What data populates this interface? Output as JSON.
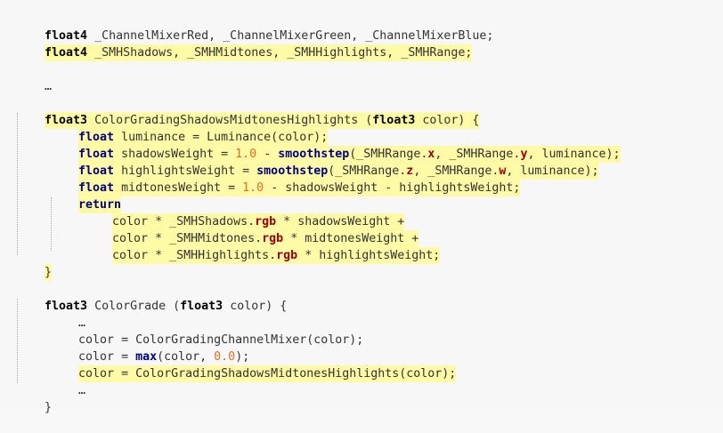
{
  "lines": {
    "l1": "float4 _ChannelMixerRed, _ChannelMixerGreen, _ChannelMixerBlue;",
    "l2a": "float4",
    "l2b": " _SMHShadows, _SMHMidtones, _SMHHighlights, _SMHRange;",
    "l4": "…",
    "l6a": "float3",
    "l6b": " ColorGradingShadowsMidtonesHighlights (",
    "l6c": "float3",
    "l6d": " color) {",
    "l7a": "float",
    "l7b": " luminance = Luminance(color);",
    "l8a": "float",
    "l8b": " shadowsWeight = ",
    "l8c": "1.0",
    "l8d": " - ",
    "l8e": "smoothstep",
    "l8f": "(_SMHRange.",
    "l8g": "x",
    "l8h": ", _SMHRange.",
    "l8i": "y",
    "l8j": ", luminance);",
    "l9a": "float",
    "l9b": " highlightsWeight = ",
    "l9c": "smoothstep",
    "l9d": "(_SMHRange.",
    "l9e": "z",
    "l9f": ", _SMHRange.",
    "l9g": "w",
    "l9h": ", luminance);",
    "l10a": "float",
    "l10b": " midtonesWeight = ",
    "l10c": "1.0",
    "l10d": " - shadowsWeight - highlightsWeight;",
    "l11": "return",
    "l12a": "color * _SMHShadows.",
    "l12b": "rgb",
    "l12c": " * shadowsWeight +",
    "l13a": "color * _SMHMidtones.",
    "l13b": "rgb",
    "l13c": " * midtonesWeight +",
    "l14a": "color * _SMHHighlights.",
    "l14b": "rgb",
    "l14c": " * highlightsWeight;",
    "l15": "}",
    "l17a": "float3",
    "l17b": " ColorGrade (",
    "l17c": "float3",
    "l17d": " color) {",
    "l18": "…",
    "l19": "color = ColorGradingChannelMixer(color);",
    "l20a": "color = ",
    "l20b": "max",
    "l20c": "(color, ",
    "l20d": "0.0",
    "l20e": ");",
    "l21": "color = ColorGradingShadowsMidtonesHighlights(color);",
    "l22": "…",
    "l23": "}"
  }
}
